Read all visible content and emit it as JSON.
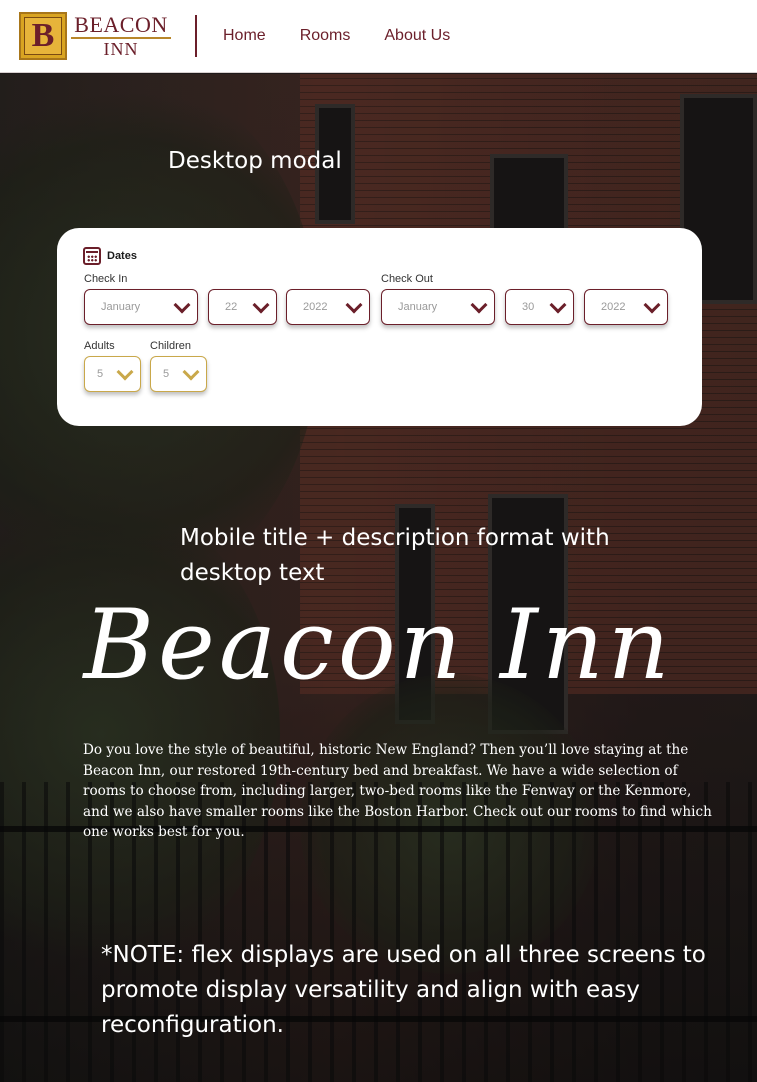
{
  "header": {
    "logo": {
      "initial": "B",
      "line1": "BEACON",
      "line2": "INN"
    },
    "nav": [
      {
        "label": "Home"
      },
      {
        "label": "Rooms"
      },
      {
        "label": "About Us"
      }
    ]
  },
  "annotations": {
    "modal": "Desktop modal",
    "mobile": "Mobile title + description format with desktop text",
    "note": "*NOTE: flex displays are used on all three screens to promote display versatility and align with easy reconfiguration."
  },
  "modal": {
    "heading": "Dates",
    "check_in_label": "Check In",
    "check_out_label": "Check Out",
    "check_in": {
      "month": "January",
      "day": "22",
      "year": "2022"
    },
    "check_out": {
      "month": "January",
      "day": "30",
      "year": "2022"
    },
    "adults_label": "Adults",
    "children_label": "Children",
    "adults": "5",
    "children": "5",
    "colors": {
      "accent": "#6b1f2a",
      "gold": "#c9a84a"
    }
  },
  "hero": {
    "title": "Beacon Inn",
    "description": "Do you love the style of beautiful, historic New England? Then you’ll love staying at the Beacon Inn, our restored 19th-century bed and breakfast. We have a wide selection of rooms to choose from, including larger, two-bed rooms like the Fenway or the Kenmore, and we also have smaller rooms like the Boston Harbor. Check out our rooms to find which one works best for you."
  }
}
